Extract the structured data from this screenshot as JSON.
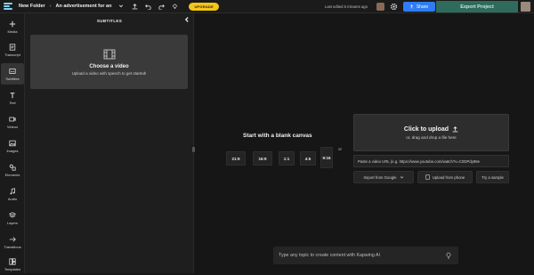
{
  "topbar": {
    "folder": "New Folder",
    "separator": "›",
    "project": "An advertisement for an",
    "upgrade": "UPGRADE",
    "last_edited": "Last edited 5 minutes ago",
    "share": "Share",
    "export": "Export Project"
  },
  "nav": [
    {
      "label": "Media",
      "icon": "plus-icon"
    },
    {
      "label": "Transcript",
      "icon": "transcript-icon"
    },
    {
      "label": "Subtitles",
      "icon": "subtitles-icon"
    },
    {
      "label": "Text",
      "icon": "text-icon"
    },
    {
      "label": "Videos",
      "icon": "video-icon"
    },
    {
      "label": "Images",
      "icon": "image-icon"
    },
    {
      "label": "Elements",
      "icon": "elements-icon"
    },
    {
      "label": "Audio",
      "icon": "audio-icon"
    },
    {
      "label": "Layers",
      "icon": "layers-icon"
    },
    {
      "label": "Transitions",
      "icon": "transitions-icon"
    },
    {
      "label": "Templates",
      "icon": "templates-icon"
    }
  ],
  "panel": {
    "title": "SUBTITLES",
    "choose_title": "Choose a video",
    "choose_sub": "Upload a video with speech to get started!"
  },
  "canvas": {
    "blank_title": "Start with a blank canvas",
    "ratios": [
      "21:9",
      "16:9",
      "1:1",
      "4:5",
      "9:16"
    ],
    "or": "or"
  },
  "upload": {
    "title": "Click to upload",
    "sub": "or, drag and drop a file here",
    "url_placeholder": "Paste a video URL (e.g. https://www.youtube.com/watch?v=C0DPdy98e",
    "import_google": "Import from Google",
    "upload_phone": "Upload from phone",
    "sample": "Try a sample"
  },
  "ai": {
    "placeholder": "Type any topic to create content with Kapwing AI"
  },
  "colors": {
    "accent_blue": "#2f7cf6",
    "upgrade_yellow": "#f5c518",
    "export_green": "#2f6b5c"
  }
}
